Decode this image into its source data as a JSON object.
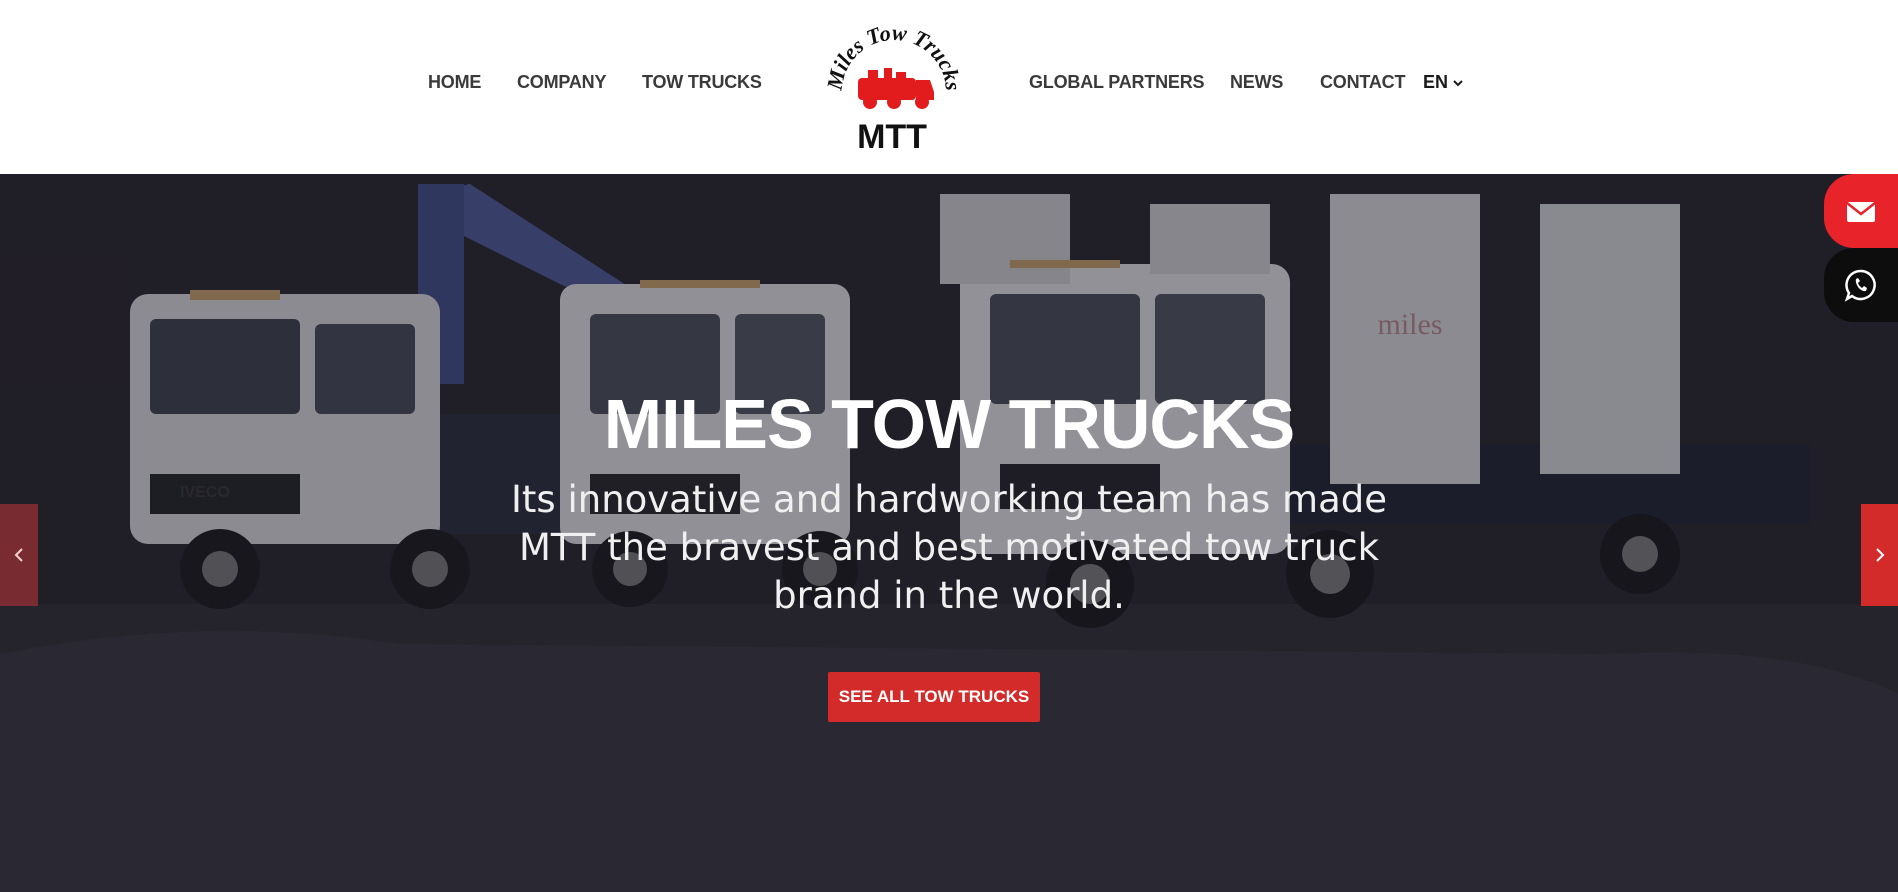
{
  "nav": {
    "left": [
      "HOME",
      "COMPANY",
      "TOW TRUCKS"
    ],
    "right": [
      "GLOBAL PARTNERS",
      "NEWS",
      "CONTACT"
    ],
    "language": "EN"
  },
  "logo": {
    "arc_text": "Miles Tow Trucks",
    "initials": "MTT",
    "icon": "tow-truck-logo-icon"
  },
  "hero": {
    "title": "MILES TOW TRUCKS",
    "subtitle": "Its innovative and hardworking team has made MTT the bravest and best motivated tow truck brand in the world.",
    "button_label": "SEE ALL TOW TRUCKS",
    "truck_brand_badge": "IVECO",
    "truck_body_badge": "miles",
    "prev_icon": "chevron-left-icon",
    "next_icon": "chevron-right-icon"
  },
  "floating": {
    "mail_icon": "envelope-icon",
    "whatsapp_icon": "whatsapp-icon"
  },
  "colors": {
    "accent": "#d32a2a",
    "nav_text": "#3a3a3a",
    "hero_bg": "#24212a",
    "whatsapp_bg": "#0d0d0d"
  }
}
